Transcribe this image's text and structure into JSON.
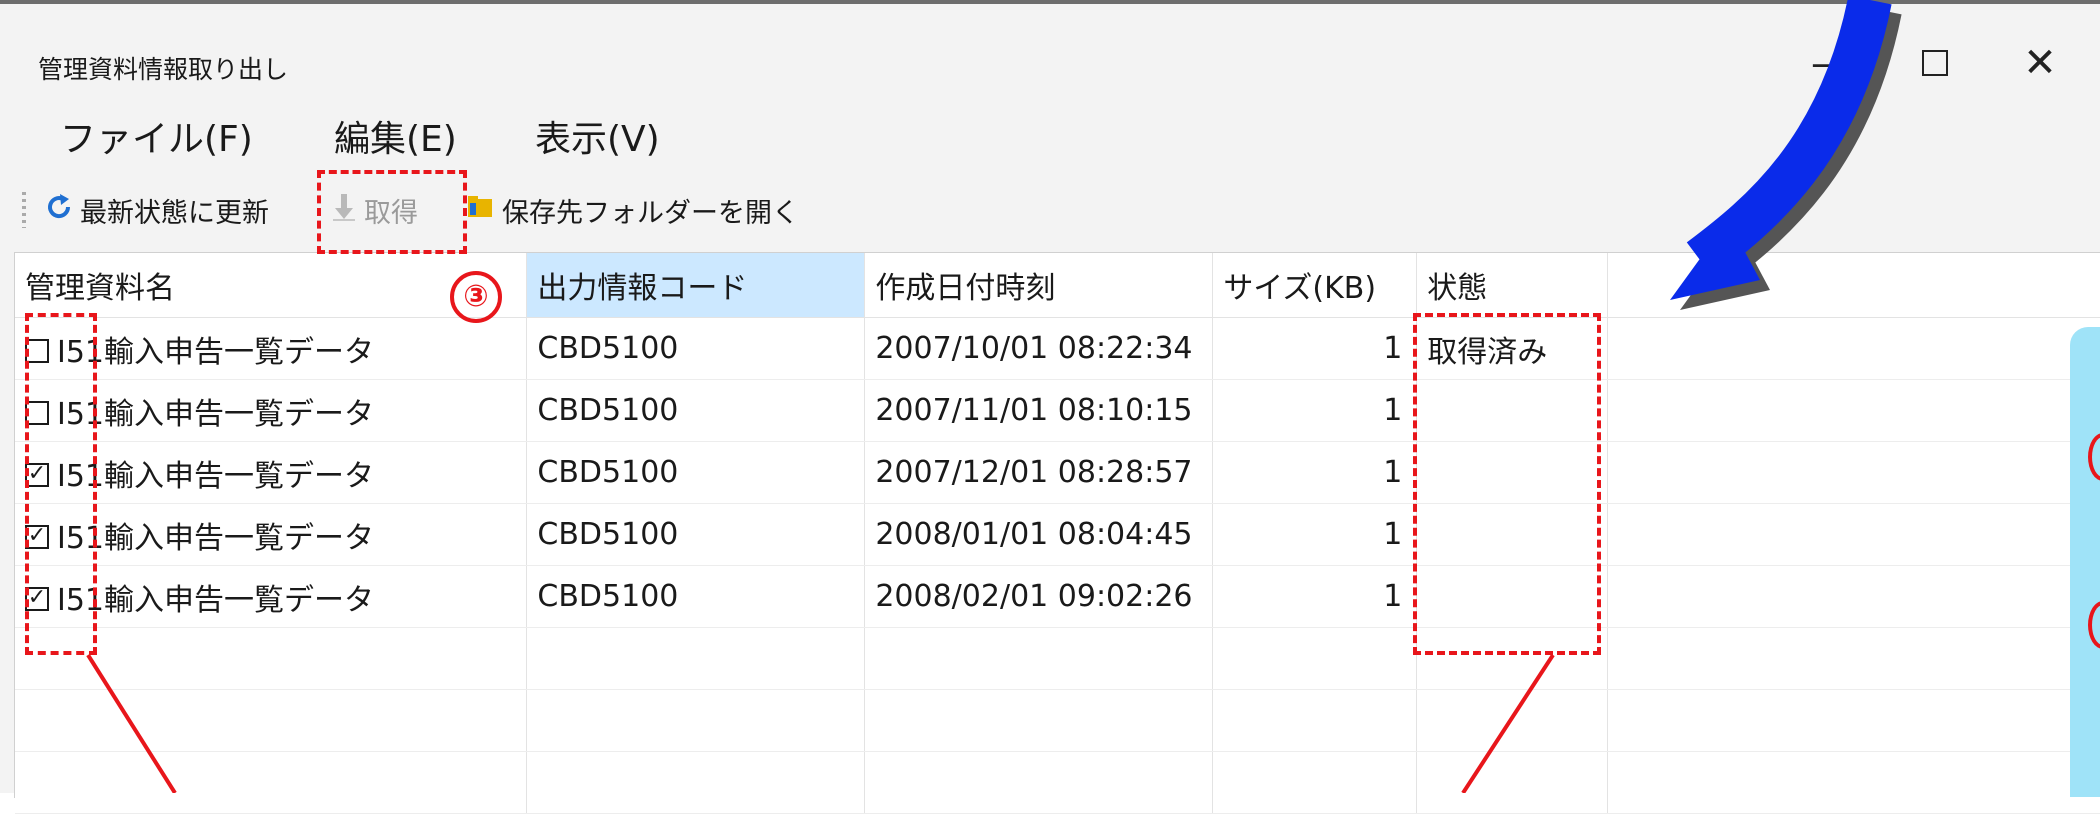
{
  "window": {
    "title": "管理資料情報取り出し",
    "minimize_icon": "minimize-icon",
    "maximize_icon": "maximize-icon",
    "close_icon": "close-icon"
  },
  "menu": {
    "file": "ファイル(F)",
    "edit": "編集(E)",
    "view": "表示(V)"
  },
  "toolbar": {
    "refresh": {
      "label": "最新状態に更新",
      "icon": "refresh-icon",
      "color": "#1f6fd1"
    },
    "get": {
      "label": "取得",
      "icon": "download-arrow-icon",
      "enabled": false
    },
    "open_folder": {
      "label": "保存先フォルダーを開く",
      "icon": "folder-icon",
      "color": "#e8b400"
    }
  },
  "grid": {
    "columns": [
      "管理資料名",
      "出力情報コード",
      "作成日付時刻",
      "サイズ(KB)",
      "状態"
    ],
    "sorted_column": 1,
    "rows": [
      {
        "checked": false,
        "name": "I51輸入申告一覧データ",
        "code": "CBD5100",
        "datetime": "2007/10/01 08:22:34",
        "size": "1",
        "status": "取得済み"
      },
      {
        "checked": false,
        "name": "I51輸入申告一覧データ",
        "code": "CBD5100",
        "datetime": "2007/11/01 08:10:15",
        "size": "1",
        "status": ""
      },
      {
        "checked": true,
        "name": "I51輸入申告一覧データ",
        "code": "CBD5100",
        "datetime": "2007/12/01 08:28:57",
        "size": "1",
        "status": ""
      },
      {
        "checked": true,
        "name": "I51輸入申告一覧データ",
        "code": "CBD5100",
        "datetime": "2008/01/01 08:04:45",
        "size": "1",
        "status": ""
      },
      {
        "checked": true,
        "name": "I51輸入申告一覧データ",
        "code": "CBD5100",
        "datetime": "2008/02/01 09:02:26",
        "size": "1",
        "status": ""
      }
    ],
    "empty_rows": 3
  },
  "annotations": {
    "step_number": "③",
    "highlight_color": "#e8161b",
    "arrow_color": "#0a2bea",
    "callout_color": "#9fe3f8"
  }
}
